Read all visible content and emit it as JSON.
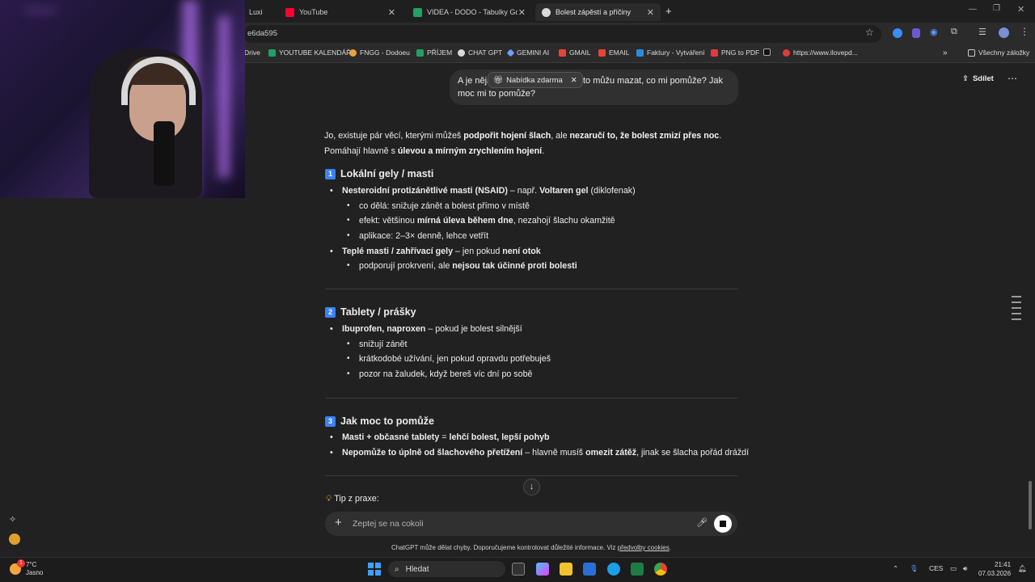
{
  "browser": {
    "tabs": [
      {
        "label": "Luxi",
        "color": "#ffffff"
      },
      {
        "label": "YouTube",
        "color": "#ff0033"
      },
      {
        "label": "VIDEA - DODO - Tabulky Googl",
        "color": "#1ea362"
      },
      {
        "label": "Bolest zápěstí a příčiny",
        "color": "#d9d9d9"
      }
    ],
    "url": "e6da595",
    "bookmarks": [
      {
        "label": "Drive",
        "color": "#4285f4"
      },
      {
        "label": "YOUTUBE KALENDÁŘ",
        "color": "#1ea362"
      },
      {
        "label": "FNGG - Dodoeu",
        "color": "#e8a33d"
      },
      {
        "label": "PŘÍJEM",
        "color": "#1ea362"
      },
      {
        "label": "CHAT GPT",
        "color": "#d9d9d9"
      },
      {
        "label": "GEMINI AI",
        "color": "#6aa0ff"
      },
      {
        "label": "GMAIL",
        "color": "#ea4335"
      },
      {
        "label": "EMAIL",
        "color": "#ea4335"
      },
      {
        "label": "Faktury - Vytváření",
        "color": "#2d8ae0"
      },
      {
        "label": "PNG to PDF",
        "color": "#e33b3b"
      },
      {
        "label": "https://www.ilovepd...",
        "color": "#e33b3b"
      }
    ],
    "all_bookmarks": "Všechny záložky"
  },
  "chat": {
    "share_label": "Sdílet",
    "user_message": "A je něj…     čím to můžu mazat, co mi pomůže? Jak moc mi to pomůže?",
    "user_prefix": "A je nějá",
    "user_rest": "čím to můžu mazat, co mi pomůže? Jak moc mi to pomůže?",
    "offer_badge": "Nabídka zdarma",
    "intro_1": "Jo, existuje pár věcí, kterými můžeš ",
    "intro_1b": "podpořit hojení šlach",
    "intro_1c": ", ale ",
    "intro_1d": "nezaručí to, že bolest zmizí přes noc",
    "intro_1e": ".",
    "intro_2": "Pomáhají hlavně s ",
    "intro_2b": "úlevou a mírným zrychlením hojení",
    "intro_2c": ".",
    "sections": [
      {
        "num": "1",
        "title": "Lokální gely / masti"
      },
      {
        "num": "2",
        "title": "Tablety / prášky"
      },
      {
        "num": "3",
        "title": "Jak moc to pomůže"
      }
    ],
    "s1": {
      "b1_bold": "Nesteroidní protizánětlivé masti (NSAID)",
      "b1_rest": " – např. ",
      "b1_bold2": "Voltaren gel",
      "b1_rest2": " (diklofenak)",
      "b1_sub1": "co dělá: snižuje zánět a bolest přímo v místě",
      "b1_sub2_pre": "efekt: většinou ",
      "b1_sub2_bold": "mírná úleva během dne",
      "b1_sub2_post": ", nezahojí šlachu okamžitě",
      "b1_sub3": "aplikace: 2–3× denně, lehce vetřít",
      "b2_bold": "Teplé masti / zahřívací gely",
      "b2_rest": " – jen pokud ",
      "b2_bold2": "není otok",
      "b2_sub1_pre": "podporují prokrvení, ale ",
      "b2_sub1_bold": "nejsou tak účinné proti bolesti"
    },
    "s2": {
      "b1_bold": "Ibuprofen, naproxen",
      "b1_rest": " – pokud je bolest silnější",
      "sub1": "snižují zánět",
      "sub2": "krátkodobé užívání, jen pokud opravdu potřebuješ",
      "sub3": "pozor na žaludek, když bereš víc dní po sobě"
    },
    "s3": {
      "b1_bold": "Masti + občasné tablety",
      "b1_rest": " = ",
      "b1_bold2": "lehčí bolest, lepší pohyb",
      "b2_bold": "Nepomůže to úplně od šlachového přetížení",
      "b2_rest": " – hlavně musíš ",
      "b2_bold2": "omezit zátěž",
      "b2_rest2": ", jinak se šlacha pořád dráždí"
    },
    "tip": "Tip z praxe:",
    "composer_placeholder": "Zeptej se na cokoli",
    "footnote_pre": "ChatGPT může dělat chyby. Doporučujeme kontrolovat důležité informace. Viz ",
    "footnote_link": "předvolby cookies",
    "footnote_post": "."
  },
  "taskbar": {
    "weather_temp": "7°C",
    "weather_text": "Jasno",
    "notif_count": "1",
    "search_label": "Hledat",
    "lang": "CES",
    "time": "21:41",
    "date": "07.03.2026"
  }
}
